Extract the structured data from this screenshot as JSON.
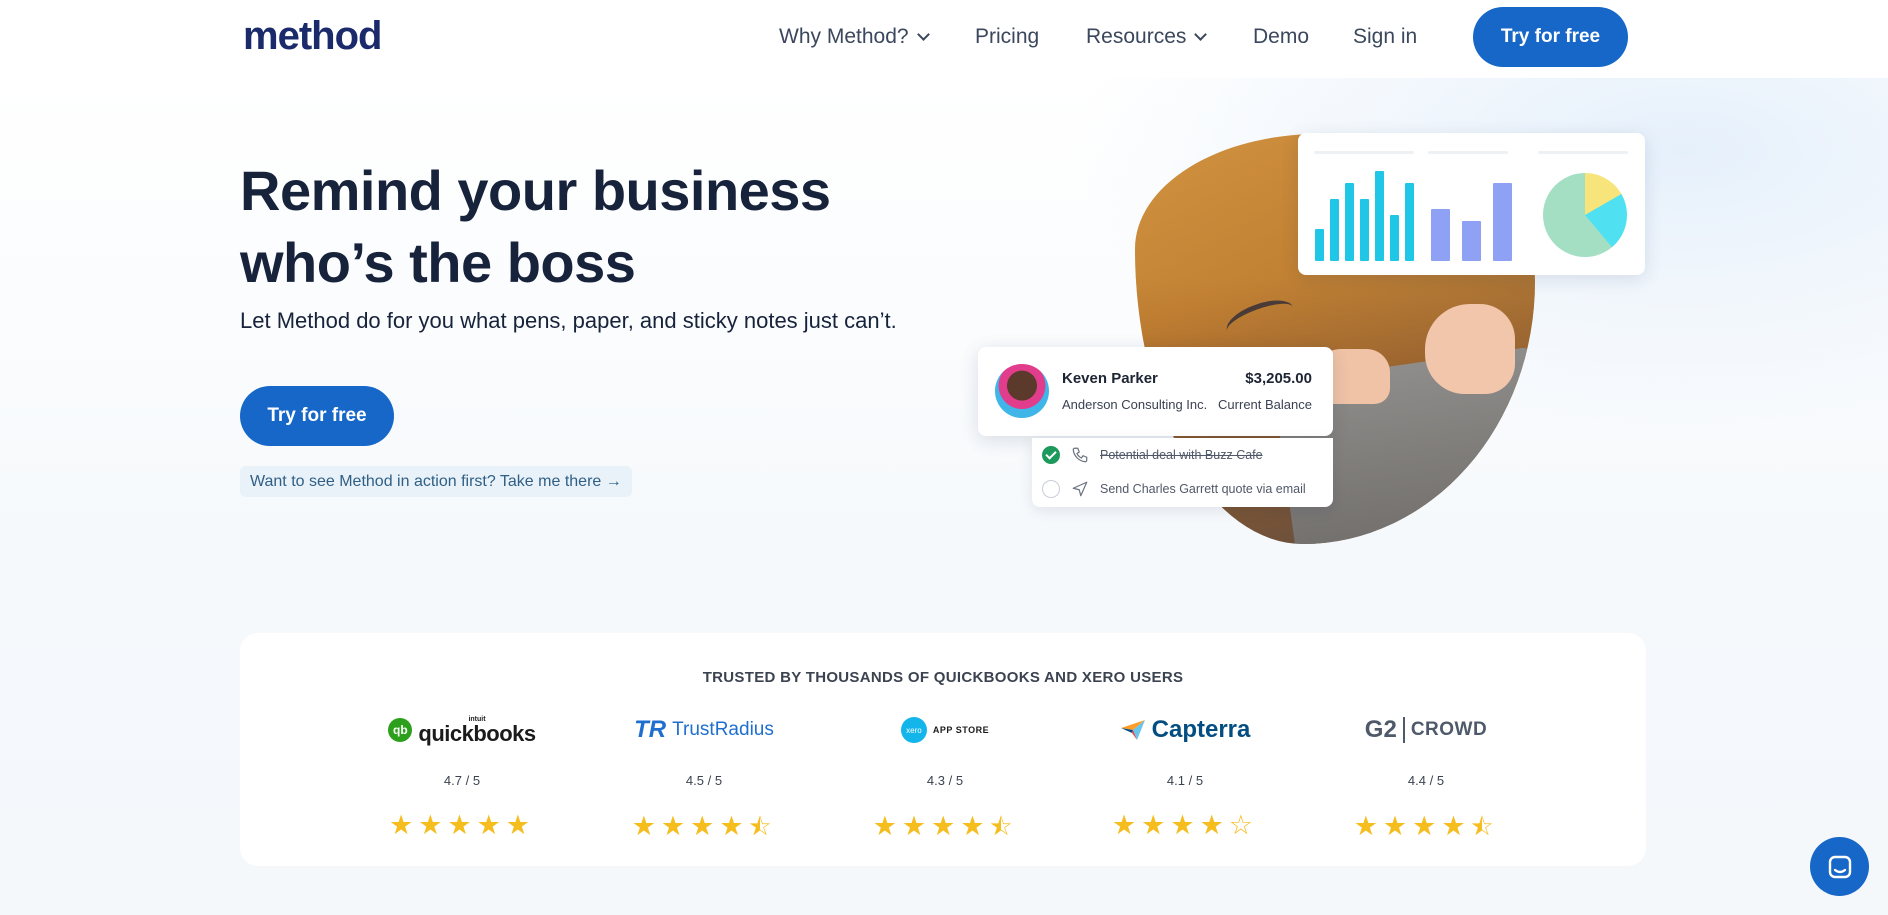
{
  "nav": {
    "logo": "method",
    "links": [
      {
        "label": "Why Method?",
        "dropdown": true
      },
      {
        "label": "Pricing",
        "dropdown": false
      },
      {
        "label": "Resources",
        "dropdown": true
      },
      {
        "label": "Demo",
        "dropdown": false
      },
      {
        "label": "Sign in",
        "dropdown": false
      }
    ],
    "cta_label": "Try for free"
  },
  "hero": {
    "title": "Remind your business who’s the boss",
    "subtitle": "Let Method do for you what pens, paper, and sticky notes just can’t.",
    "cta_label": "Try for free",
    "demo_link": "Want to see Method in action first? Take me there →"
  },
  "illustration": {
    "customer": {
      "name": "Keven Parker",
      "company": "Anderson Consulting Inc.",
      "amount": "$3,205.00",
      "amount_label": "Current Balance"
    },
    "tasks": [
      {
        "label": "Potential deal with Buzz Cafe",
        "done": true,
        "icon": "phone-icon"
      },
      {
        "label": "Send Charles Garrett quote via email",
        "done": false,
        "icon": "send-icon"
      }
    ],
    "colors": {
      "cyan_bars": "#1fc6e6",
      "purple_bars": "#8fa1f4",
      "pie": [
        "#f7e47a",
        "#4fe1f2",
        "#a4dfc3"
      ]
    }
  },
  "trust": {
    "heading": "TRUSTED BY THOUSANDS OF QUICKBOOKS AND XERO USERS",
    "ratings": [
      {
        "brand": "quickbooks",
        "brand_prefix": "intuit",
        "score": "4.7 / 5",
        "stars": 5
      },
      {
        "brand": "TrustRadius",
        "score": "4.5 / 5",
        "stars": 4.5
      },
      {
        "brand": "APP STORE",
        "brand_prefix": "xero",
        "score": "4.3 / 5",
        "stars": 4.5
      },
      {
        "brand": "Capterra",
        "score": "4.1 / 5",
        "stars": 4
      },
      {
        "brand": "CROWD",
        "brand_prefix": "G2",
        "score": "4.4 / 5",
        "stars": 4.5
      }
    ]
  },
  "colors": {
    "brand_blue": "#1767c9",
    "star_yellow": "#f5bd1e",
    "heading_navy": "#17223b"
  }
}
